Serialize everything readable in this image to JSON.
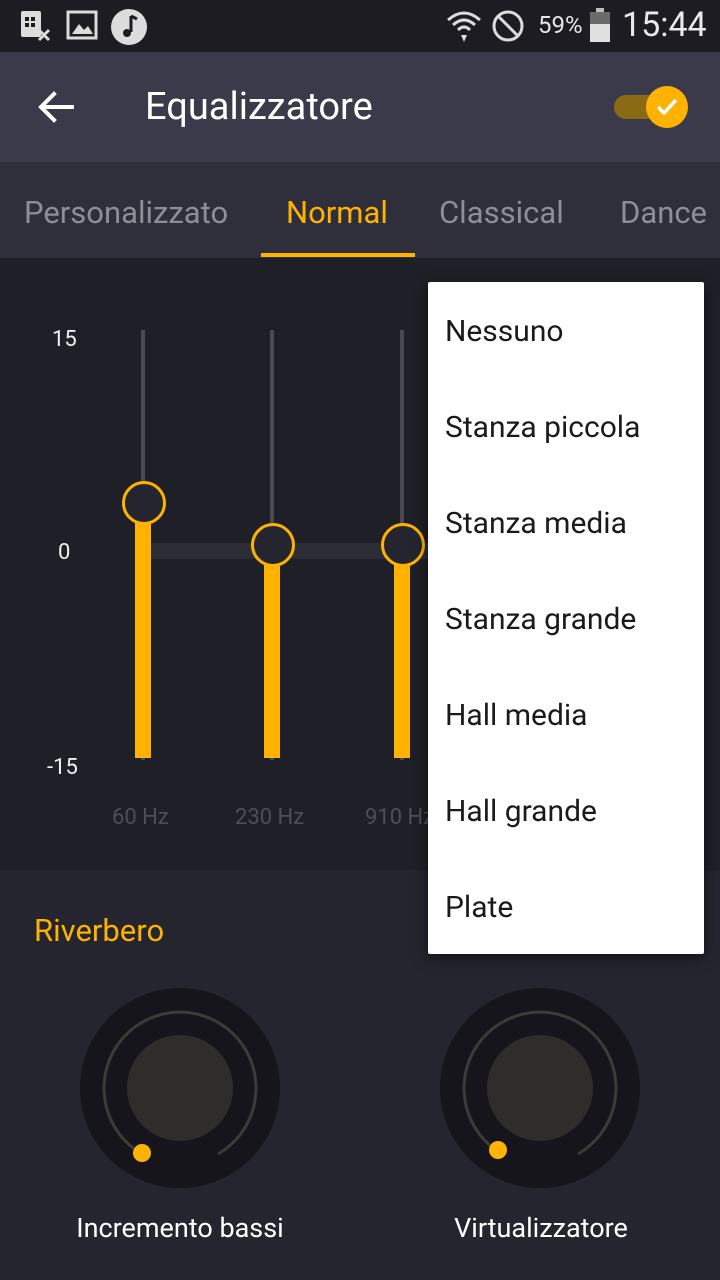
{
  "status_bar": {
    "icons": [
      "sim-card-off-icon",
      "image-icon",
      "music-note-icon",
      "wifi-icon",
      "do-not-disturb-icon",
      "battery-icon"
    ],
    "battery": "59%",
    "time": "15:44"
  },
  "app_bar": {
    "title": "Equalizzatore",
    "back_icon": "arrow-left-icon",
    "toggle_on": true,
    "accent": "#ffb300"
  },
  "tabs": [
    {
      "label": "Personalizzato",
      "active": false
    },
    {
      "label": "Normal",
      "active": true
    },
    {
      "label": "Classical",
      "active": false
    },
    {
      "label": "Dance",
      "active": false
    }
  ],
  "equalizer": {
    "scale": {
      "max": "15",
      "zero": "0",
      "min": "-15"
    },
    "bands": [
      {
        "freq": "60 Hz",
        "value": 3
      },
      {
        "freq": "230 Hz",
        "value": 0
      },
      {
        "freq": "910 Hz",
        "value": 0
      }
    ]
  },
  "reverb": {
    "title": "Riverbero"
  },
  "dials": [
    {
      "label": "Incremento bassi",
      "value": 0
    },
    {
      "label": "Virtualizzatore",
      "value": 0
    }
  ],
  "reverb_menu": {
    "options": [
      "Nessuno",
      "Stanza piccola",
      "Stanza media",
      "Stanza grande",
      "Hall media",
      "Hall grande",
      "Plate"
    ]
  }
}
